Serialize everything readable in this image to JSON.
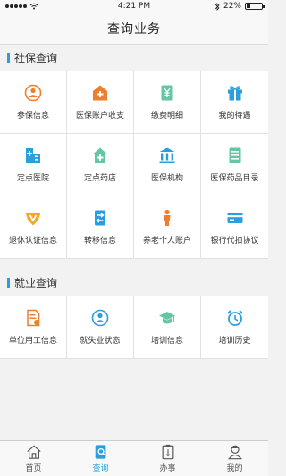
{
  "status_bar": {
    "time": "4:21 PM",
    "battery": "22%",
    "battery_level": 0.22
  },
  "header": {
    "title": "查询业务"
  },
  "sections": [
    {
      "title": "社保查询",
      "items": [
        {
          "label": "参保信息",
          "icon": "person-circle-icon",
          "color": "#f07d2b"
        },
        {
          "label": "医保账户收支",
          "icon": "hospital-cash-icon",
          "color": "#f07d2b"
        },
        {
          "label": "缴费明细",
          "icon": "yen-document-icon",
          "color": "#63c7a6"
        },
        {
          "label": "我的待遇",
          "icon": "gift-icon",
          "color": "#2a9fe0"
        },
        {
          "label": "定点医院",
          "icon": "hospital-building-icon",
          "color": "#2a9fe0"
        },
        {
          "label": "定点药店",
          "icon": "pharmacy-house-icon",
          "color": "#63c7a6"
        },
        {
          "label": "医保机构",
          "icon": "institution-icon",
          "color": "#2a9fe0"
        },
        {
          "label": "医保药品目录",
          "icon": "medicine-list-icon",
          "color": "#63c7a6"
        },
        {
          "label": "退休认证信息",
          "icon": "certificate-v-icon",
          "color": "#f5a623"
        },
        {
          "label": "转移信息",
          "icon": "transfer-icon",
          "color": "#2a9fe0"
        },
        {
          "label": "养老个人账户",
          "icon": "elderly-person-icon",
          "color": "#f07d2b"
        },
        {
          "label": "银行代扣协议",
          "icon": "bank-card-icon",
          "color": "#2a9fe0"
        }
      ]
    },
    {
      "title": "就业查询",
      "items": [
        {
          "label": "单位用工信息",
          "icon": "employment-document-icon",
          "color": "#f07d2b"
        },
        {
          "label": "就失业状态",
          "icon": "employment-status-icon",
          "color": "#2a9fe0"
        },
        {
          "label": "培训信息",
          "icon": "graduation-cap-icon",
          "color": "#63c7a6"
        },
        {
          "label": "培训历史",
          "icon": "alarm-clock-icon",
          "color": "#2a9fe0"
        }
      ]
    }
  ],
  "tabs": [
    {
      "label": "首页",
      "icon": "home-icon",
      "active": false
    },
    {
      "label": "查询",
      "icon": "search-document-icon",
      "active": true
    },
    {
      "label": "办事",
      "icon": "clipboard-icon",
      "active": false
    },
    {
      "label": "我的",
      "icon": "user-profile-icon",
      "active": false
    }
  ]
}
